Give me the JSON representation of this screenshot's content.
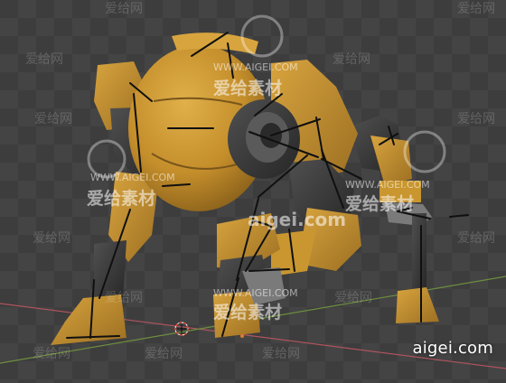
{
  "viewport": {
    "background": "#444444",
    "checker_dark": "#3a3a3a",
    "checker_light": "#4a4a4a",
    "x_axis_color": "#b0545e",
    "y_axis_color": "#6e8e3f",
    "cursor_color": "#e04a38"
  },
  "model": {
    "name": "yellow-quadruped-robot",
    "body_color": "#c9962f",
    "dark_color": "#343434",
    "metal_color": "#6a6a6a",
    "bone_color": "#101010"
  },
  "watermarks": {
    "site_url": "WWW.AIGEI.COM",
    "site_cn": "爱给素材",
    "site_short": "aigei.com",
    "tile_cn": "爱给网",
    "corner_logo": "aigei.com"
  }
}
